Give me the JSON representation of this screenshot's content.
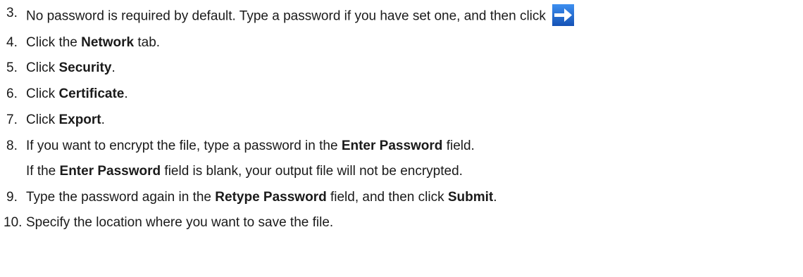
{
  "steps": [
    {
      "num": "3.",
      "parts": [
        {
          "t": "No password is required by default. Type a password if you have set one, and then click ",
          "b": false
        }
      ],
      "icon": "arrow-right-icon",
      "icon_color": "#1f6fd1"
    },
    {
      "num": "4.",
      "parts": [
        {
          "t": "Click the ",
          "b": false
        },
        {
          "t": "Network",
          "b": true
        },
        {
          "t": " tab.",
          "b": false
        }
      ]
    },
    {
      "num": "5.",
      "parts": [
        {
          "t": "Click ",
          "b": false
        },
        {
          "t": "Security",
          "b": true
        },
        {
          "t": ".",
          "b": false
        }
      ]
    },
    {
      "num": "6.",
      "parts": [
        {
          "t": "Click ",
          "b": false
        },
        {
          "t": "Certificate",
          "b": true
        },
        {
          "t": ".",
          "b": false
        }
      ]
    },
    {
      "num": "7.",
      "parts": [
        {
          "t": "Click ",
          "b": false
        },
        {
          "t": "Export",
          "b": true
        },
        {
          "t": ".",
          "b": false
        }
      ]
    },
    {
      "num": "8.",
      "parts": [
        {
          "t": "If you want to encrypt the file, type a password in the ",
          "b": false
        },
        {
          "t": "Enter Password",
          "b": true
        },
        {
          "t": " field.",
          "b": false
        }
      ],
      "note": [
        {
          "t": "If the ",
          "b": false
        },
        {
          "t": "Enter Password",
          "b": true
        },
        {
          "t": " field is blank, your output file will not be encrypted.",
          "b": false
        }
      ]
    },
    {
      "num": "9.",
      "parts": [
        {
          "t": "Type the password again in the ",
          "b": false
        },
        {
          "t": "Retype Password",
          "b": true
        },
        {
          "t": " field, and then click ",
          "b": false
        },
        {
          "t": "Submit",
          "b": true
        },
        {
          "t": ".",
          "b": false
        }
      ]
    },
    {
      "num": "10.",
      "parts": [
        {
          "t": "Specify the location where you want to save the file.",
          "b": false
        }
      ]
    }
  ]
}
